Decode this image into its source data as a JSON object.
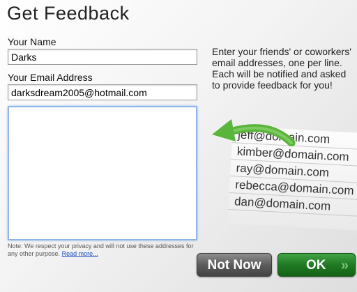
{
  "dialog": {
    "title": "Get Feedback"
  },
  "form": {
    "name_label": "Your Name",
    "name_value": "Darks",
    "email_label": "Your Email Address",
    "email_value": "darksdream2005@hotmail.com",
    "recipients_value": ""
  },
  "instructions": "Enter your friends' or coworkers' email addresses, one per line. Each will be notified and asked to provide feedback for you!",
  "example_emails": [
    "jeff@domain.com",
    "kimber@domain.com",
    "ray@domain.com",
    "rebecca@domain.com",
    "dan@domain.com"
  ],
  "privacy": {
    "text": "Note: We respect your privacy and will not use these addresses for any other purpose.",
    "link": "Read more..."
  },
  "buttons": {
    "not_now": "Not Now",
    "ok": "OK",
    "ok_chevron": "»"
  },
  "colors": {
    "ok_green": "#1f7a22",
    "not_now_gray": "#5c5c5c",
    "arrow_green": "#5ab53d",
    "focus_blue": "#8fb4e6"
  }
}
